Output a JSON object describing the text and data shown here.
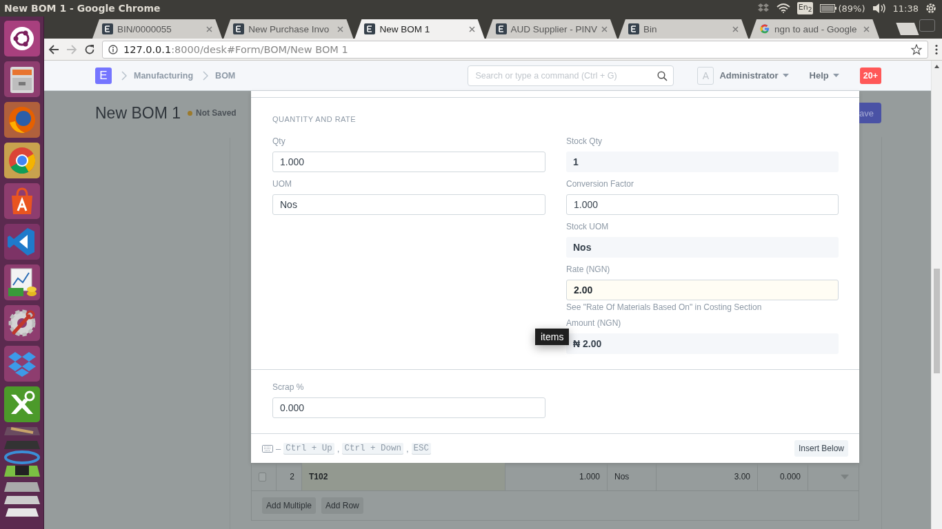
{
  "window": {
    "title": "New BOM 1 - Google Chrome"
  },
  "system_tray": {
    "keyboard": "En$_{2}$",
    "battery": "(89%)",
    "time": "11:38"
  },
  "launcher": {
    "items": [
      {
        "kind": "ubuntu"
      },
      {
        "kind": "files"
      },
      {
        "kind": "firefox"
      },
      {
        "kind": "chrome"
      },
      {
        "kind": "store"
      },
      {
        "kind": "editor"
      },
      {
        "kind": "finance"
      },
      {
        "kind": "settings"
      },
      {
        "kind": "dropbox"
      },
      {
        "kind": "xmind"
      },
      {
        "kind": "stack"
      }
    ]
  },
  "tabs": [
    {
      "label": "BIN/0000055",
      "kind": "erp",
      "selected": false
    },
    {
      "label": "New Purchase Invo",
      "kind": "erp",
      "selected": false
    },
    {
      "label": "New BOM 1",
      "kind": "erp",
      "selected": true
    },
    {
      "label": "AUD Supplier - PINV",
      "kind": "erp",
      "selected": false
    },
    {
      "label": "Bin",
      "kind": "erp",
      "selected": false
    },
    {
      "label": "ngn to aud - Google",
      "kind": "google",
      "selected": false
    }
  ],
  "address_bar": {
    "host": "127.0.0.1",
    "rest": ":8000/desk#Form/BOM/New BOM 1"
  },
  "navbar": {
    "logo": "E",
    "breadcrumbs": [
      "Manufacturing",
      "BOM"
    ],
    "search": {
      "placeholder": "Search or type a command (Ctrl + G)"
    },
    "avatar": "A",
    "user": "Administrator",
    "help": "Help",
    "notifications": "20+"
  },
  "page": {
    "title": "New BOM 1",
    "status": "Not Saved",
    "save_button": "ave"
  },
  "row_editor": {
    "section": "QUANTITY AND RATE",
    "left_fields": [
      {
        "label": "Qty",
        "value": "1.000",
        "kind": "input"
      },
      {
        "label": "UOM",
        "value": "Nos",
        "kind": "input"
      }
    ],
    "right_fields": [
      {
        "label": "Stock Qty",
        "value": "1",
        "kind": "readonly"
      },
      {
        "label": "Conversion Factor",
        "value": "1.000",
        "kind": "input"
      },
      {
        "label": "Stock UOM",
        "value": "Nos",
        "kind": "readonly"
      },
      {
        "label": "Rate (NGN)",
        "value": "2.00",
        "kind": "highlighted",
        "help": "See \"Rate Of Materials Based On\" in Costing Section"
      },
      {
        "label": "Amount (NGN)",
        "value": "₦ 2.00",
        "kind": "readonly",
        "tooltip": "items"
      }
    ],
    "scrap": {
      "label": "Scrap %",
      "value": "0.000"
    },
    "shortcut_dash": "–",
    "shortcut_delimiter": ",",
    "shortcuts": [
      "Ctrl + Up",
      "Ctrl + Down",
      "ESC"
    ],
    "insert_button": "Insert Below"
  },
  "items_table": {
    "rows": [
      {
        "selected": false,
        "cells": [
          "2",
          "T102",
          "1.000",
          "Nos",
          "3.00",
          "0.000"
        ]
      }
    ],
    "buttons": [
      "Add Multiple",
      "Add Row"
    ]
  }
}
